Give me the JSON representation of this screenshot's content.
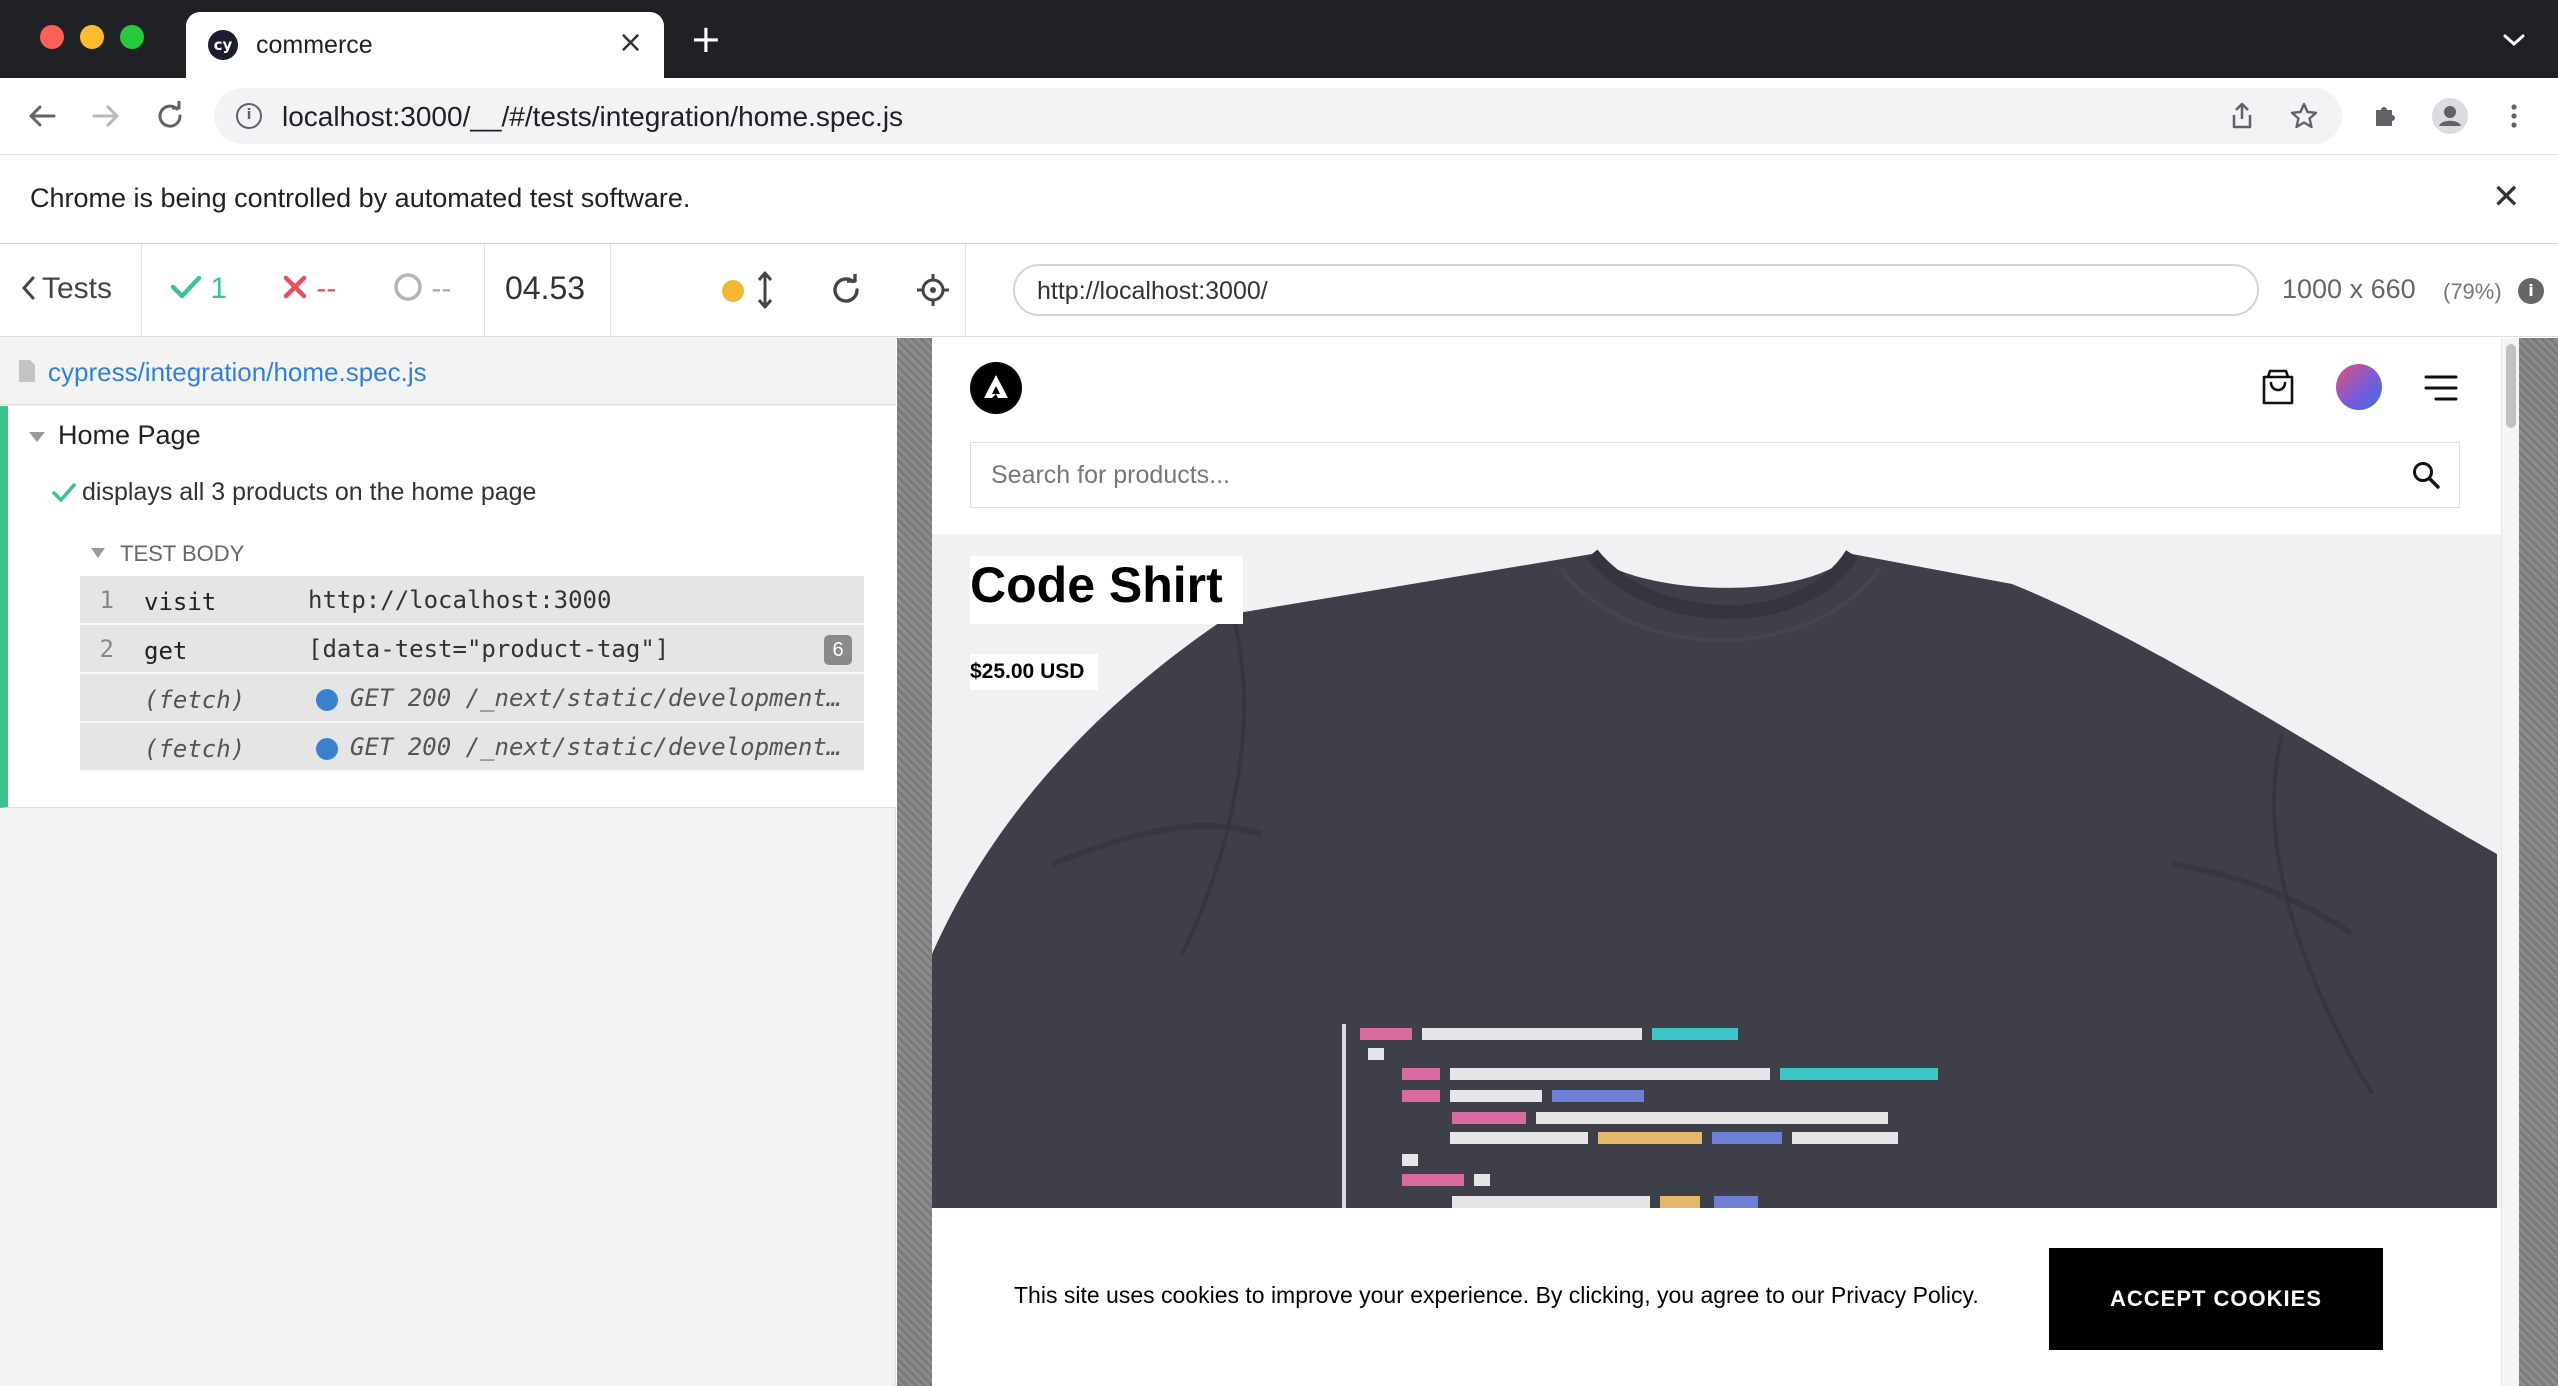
{
  "browser": {
    "tab_title": "commerce",
    "favicon_text": "cy",
    "url": "localhost:3000/__/#/tests/integration/home.spec.js",
    "infobar_message": "Chrome is being controlled by automated test software."
  },
  "reporter": {
    "tests_label": "Tests",
    "passed": "1",
    "failed": "--",
    "pending": "--",
    "duration": "04.53",
    "spec_path": "cypress/integration/home.spec.js",
    "suite_title": "Home Page",
    "test_title": "displays all 3 products on the home page",
    "test_body_label": "TEST BODY",
    "commands": [
      {
        "num": "1",
        "name": "visit",
        "message": "http://localhost:3000"
      },
      {
        "num": "2",
        "name": "get",
        "message": "[data-test=\"product-tag\"]",
        "badge": "6"
      },
      {
        "name": "(fetch)",
        "message": "GET 200 /_next/static/development…"
      },
      {
        "name": "(fetch)",
        "message": "GET 200 /_next/static/development…"
      }
    ]
  },
  "aut": {
    "url": "http://localhost:3000/",
    "viewport_size": "1000 x 660",
    "scale": "(79%)"
  },
  "site": {
    "search_placeholder": "Search for products...",
    "product_name": "Code Shirt",
    "product_price": "$25.00 USD",
    "cookie_message": "This site uses cookies to improve your experience. By clicking, you agree to our Privacy Policy.",
    "accept_label": "ACCEPT COOKIES"
  },
  "colors": {
    "pass": "#3cc48c",
    "fail": "#e94f5f",
    "link": "#3380d9",
    "shirt": "#3f3f4a"
  }
}
